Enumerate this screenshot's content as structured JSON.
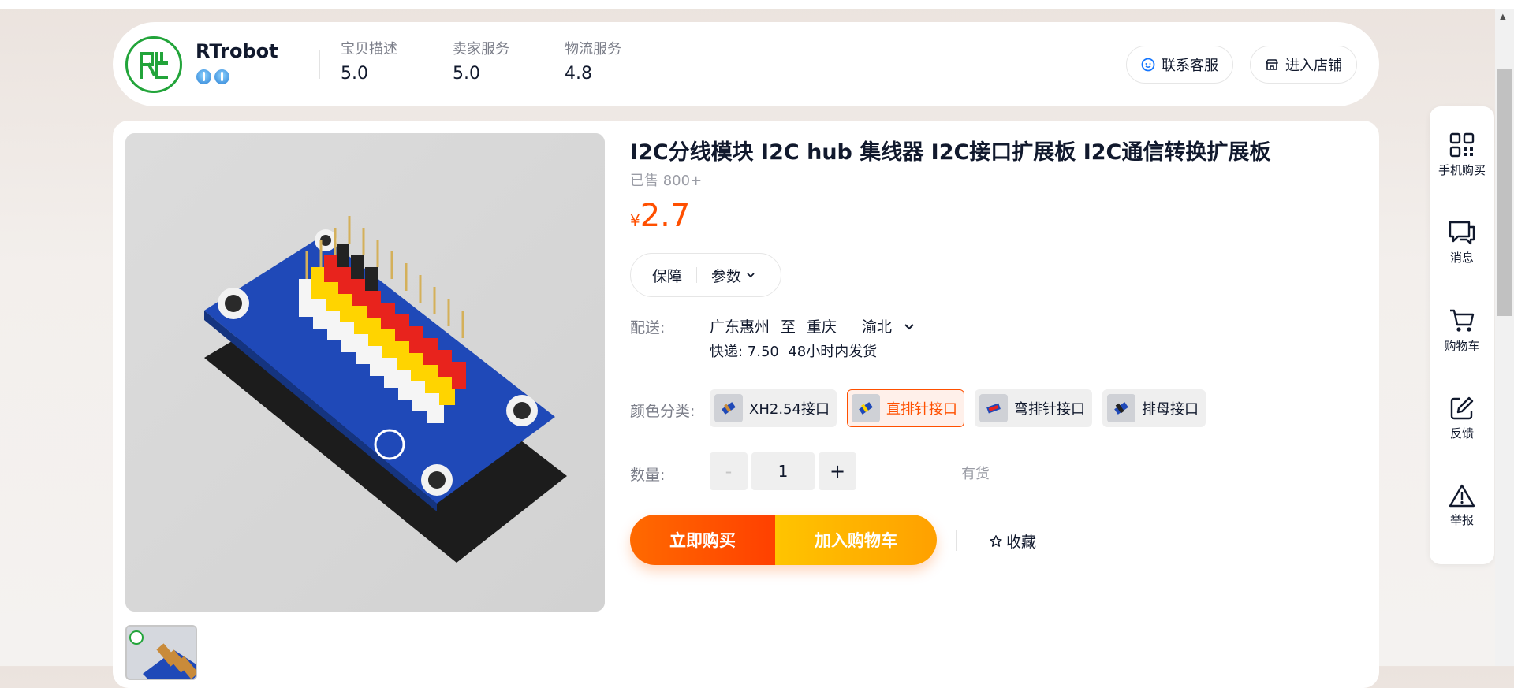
{
  "shop": {
    "name": "RTrobot",
    "ratings": [
      {
        "label": "宝贝描述",
        "value": "5.0"
      },
      {
        "label": "卖家服务",
        "value": "5.0"
      },
      {
        "label": "物流服务",
        "value": "4.8"
      }
    ],
    "contact_label": "联系客服",
    "enter_shop_label": "进入店铺"
  },
  "product": {
    "title": "I2C分线模块 I2C hub 集线器 I2C接口扩展板 I2C通信转换扩展板",
    "sold": "已售 800+",
    "currency": "¥",
    "price": "2.7",
    "guarantee_label": "保障",
    "params_label": "参数"
  },
  "shipping": {
    "label": "配送:",
    "from": "广东惠州",
    "to_word": "至",
    "city": "重庆",
    "district": "渝北",
    "fee": "快递: 7.50",
    "dispatch": "48小时内发货"
  },
  "color": {
    "label": "颜色分类:",
    "options": [
      {
        "label": "XH2.54接口",
        "selected": false
      },
      {
        "label": "直排针接口",
        "selected": true
      },
      {
        "label": "弯排针接口",
        "selected": false
      },
      {
        "label": "排母接口",
        "selected": false
      }
    ]
  },
  "quantity": {
    "label": "数量:",
    "minus": "-",
    "value": "1",
    "plus": "+",
    "stock": "有货"
  },
  "actions": {
    "buy_now": "立即购买",
    "add_cart": "加入购物车",
    "favorite": "收藏"
  },
  "sidebar": {
    "items": [
      {
        "label": "手机购买",
        "icon": "qr-code-icon"
      },
      {
        "label": "消息",
        "icon": "message-icon"
      },
      {
        "label": "购物车",
        "icon": "cart-icon"
      },
      {
        "label": "反馈",
        "icon": "edit-icon"
      },
      {
        "label": "举报",
        "icon": "warning-icon"
      }
    ]
  },
  "colors": {
    "accent": "#ff5000",
    "price": "#ff4f00",
    "logo_green": "#22a43a",
    "cart_yellow": "#ffb400"
  }
}
